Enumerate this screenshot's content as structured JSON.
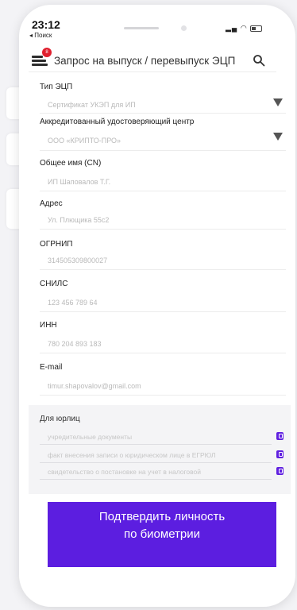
{
  "status_bar": {
    "time": "23:12",
    "back_label": "◂ Поиск"
  },
  "header": {
    "title": "Запрос на выпуск / перевыпуск ЭЦП",
    "badge": "8"
  },
  "form": {
    "ecp_type": {
      "label": "Тип ЭЦП",
      "value": "Сертификат УКЭП для ИП"
    },
    "center": {
      "label": "Аккредитованный удостоверяющий центр",
      "value": "ООО «КРИПТО-ПРО»"
    },
    "cn": {
      "label": "Общее имя (CN)",
      "value": "ИП Шаповалов Т.Г."
    },
    "address": {
      "label": "Адрес",
      "value": "Ул. Плющика 55с2"
    },
    "ogrnip": {
      "label": "ОГРНИП",
      "value": "314505309800027"
    },
    "snils": {
      "label": "СНИЛС",
      "value": "123 456 789 64"
    },
    "inn": {
      "label": "ИНН",
      "value": "780 204 893 183"
    },
    "email": {
      "label": "E-mail",
      "value": "timur.shapovalov@gmail.com"
    }
  },
  "legal": {
    "title": "Для юрлиц",
    "items": [
      "учредительные документы",
      "факт внесения записи о юридическом лице в ЕГРЮЛ",
      "свидетельство о постановке на учет в налоговой"
    ]
  },
  "confirm_button": {
    "line1": "Подтвердить личность",
    "line2": "по биометрии"
  },
  "colors": {
    "accent": "#5c1ee0",
    "badge": "#e0202f"
  }
}
